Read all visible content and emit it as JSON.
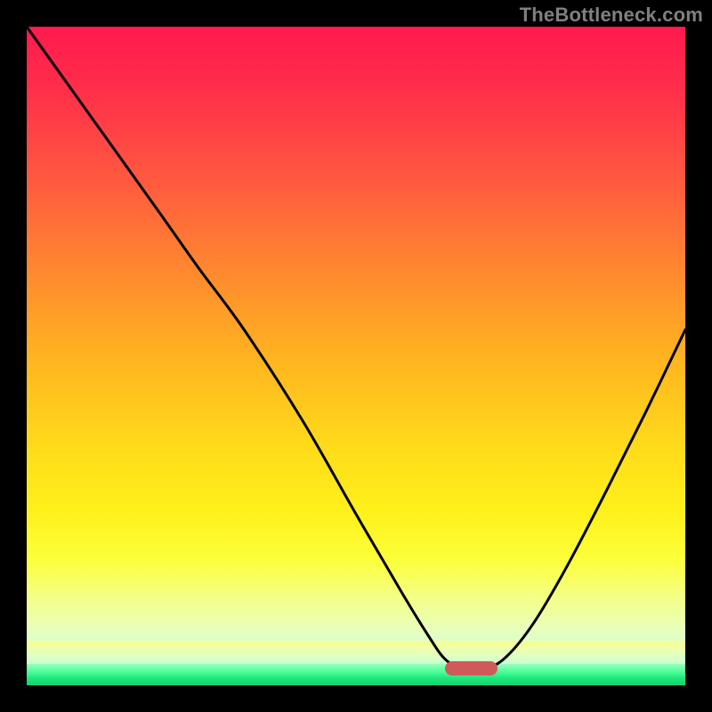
{
  "attribution": "TheBottleneck.com",
  "colors": {
    "frame": "#000000",
    "attribution_text": "#808080",
    "curve": "#000000",
    "marker": "#d05a5a",
    "gradient_top": "#ff1a4d",
    "gradient_bottom_green": "#12d46e"
  },
  "chart_data": {
    "type": "line",
    "title": "",
    "xlabel": "",
    "ylabel": "",
    "xlim": [
      0,
      100
    ],
    "ylim": [
      0,
      100
    ],
    "notes": "Bottleneck-style V curve over red→yellow→green vertical gradient. Values are percent of plot width (x) and percent of plot height from top (y).",
    "series": [
      {
        "name": "curve",
        "points": [
          {
            "x": 0.0,
            "y": 0.0
          },
          {
            "x": 10.0,
            "y": 14.0
          },
          {
            "x": 20.0,
            "y": 28.0
          },
          {
            "x": 26.0,
            "y": 36.5
          },
          {
            "x": 33.0,
            "y": 46.0
          },
          {
            "x": 42.0,
            "y": 60.0
          },
          {
            "x": 50.0,
            "y": 74.0
          },
          {
            "x": 57.0,
            "y": 86.0
          },
          {
            "x": 61.0,
            "y": 92.5
          },
          {
            "x": 63.5,
            "y": 96.0
          },
          {
            "x": 66.0,
            "y": 97.3
          },
          {
            "x": 70.0,
            "y": 97.3
          },
          {
            "x": 73.0,
            "y": 95.5
          },
          {
            "x": 77.0,
            "y": 90.5
          },
          {
            "x": 82.0,
            "y": 82.0
          },
          {
            "x": 88.0,
            "y": 70.5
          },
          {
            "x": 94.0,
            "y": 58.5
          },
          {
            "x": 100.0,
            "y": 46.0
          }
        ]
      }
    ],
    "marker": {
      "x_start": 63.5,
      "x_end": 71.5,
      "y": 97.4,
      "shape": "rounded-bar"
    },
    "gradient_bands_pct_from_top": {
      "red_to_yellow_end": 94.0,
      "pale_band_end": 96.8,
      "green_band_end": 100.0
    }
  }
}
